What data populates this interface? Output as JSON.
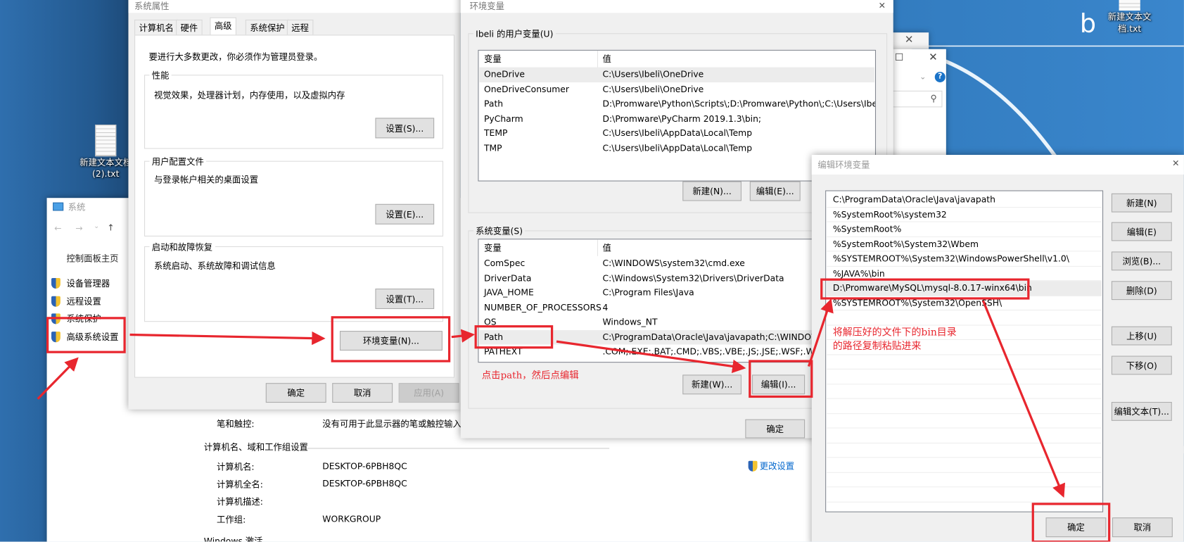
{
  "desktop": {
    "icons": [
      {
        "label_line1": "新建文本文档",
        "label_line2": "(2).txt"
      },
      {
        "label_line1": "新建文本文",
        "label_line2": "档.txt"
      }
    ],
    "letter": "b"
  },
  "system_window": {
    "title": "系统",
    "nav": {
      "back": "←",
      "forward": "→",
      "dropdown": "⌄",
      "up": "↑"
    },
    "sidebar": {
      "home": "控制面板主页",
      "items": [
        "设备管理器",
        "远程设置",
        "系统保护",
        "高级系统设置"
      ]
    },
    "pen_label": "笔和触控:",
    "pen_value": "没有可用于此显示器的笔或触控输入",
    "section_title": "计算机名、域和工作组设置",
    "fields": [
      {
        "label": "计算机名:",
        "value": "DESKTOP-6PBH8QC"
      },
      {
        "label": "计算机全名:",
        "value": "DESKTOP-6PBH8QC"
      },
      {
        "label": "计算机描述:",
        "value": ""
      },
      {
        "label": "工作组:",
        "value": "WORKGROUP"
      }
    ],
    "change_settings": "更改设置",
    "activation": "Windows 激活"
  },
  "system_properties": {
    "title": "系统属性",
    "tabs": [
      "计算机名",
      "硬件",
      "高级",
      "系统保护",
      "远程"
    ],
    "active_tab": "高级",
    "admin_note": "要进行大多数更改，你必须作为管理员登录。",
    "groups": [
      {
        "title": "性能",
        "desc": "视觉效果，处理器计划，内存使用，以及虚拟内存",
        "button": "设置(S)..."
      },
      {
        "title": "用户配置文件",
        "desc": "与登录帐户相关的桌面设置",
        "button": "设置(E)..."
      },
      {
        "title": "启动和故障恢复",
        "desc": "系统启动、系统故障和调试信息",
        "button": "设置(T)..."
      }
    ],
    "env_button": "环境变量(N)...",
    "ok": "确定",
    "cancel": "取消",
    "apply": "应用(A)"
  },
  "env_vars": {
    "title": "环境变量",
    "user_group": "Ibeli 的用户变量(U)",
    "col_var": "变量",
    "col_val": "值",
    "user_rows": [
      {
        "var": "OneDrive",
        "val": "C:\\Users\\Ibeli\\OneDrive"
      },
      {
        "var": "OneDriveConsumer",
        "val": "C:\\Users\\Ibeli\\OneDrive"
      },
      {
        "var": "Path",
        "val": "D:\\Promware\\Python\\Scripts\\;D:\\Promware\\Python\\;C:\\Users\\Ibe..."
      },
      {
        "var": "PyCharm",
        "val": "D:\\Promware\\PyCharm 2019.1.3\\bin;"
      },
      {
        "var": "TEMP",
        "val": "C:\\Users\\Ibeli\\AppData\\Local\\Temp"
      },
      {
        "var": "TMP",
        "val": "C:\\Users\\Ibeli\\AppData\\Local\\Temp"
      }
    ],
    "user_new": "新建(N)...",
    "user_edit": "编辑(E)...",
    "sys_group": "系统变量(S)",
    "sys_rows": [
      {
        "var": "ComSpec",
        "val": "C:\\WINDOWS\\system32\\cmd.exe"
      },
      {
        "var": "DriverData",
        "val": "C:\\Windows\\System32\\Drivers\\DriverData"
      },
      {
        "var": "JAVA_HOME",
        "val": "C:\\Program Files\\Java"
      },
      {
        "var": "NUMBER_OF_PROCESSORS",
        "val": "4"
      },
      {
        "var": "OS",
        "val": "Windows_NT"
      },
      {
        "var": "Path",
        "val": "C:\\ProgramData\\Oracle\\Java\\javapath;C:\\WINDOWS"
      },
      {
        "var": "PATHEXT",
        "val": ".COM;.EXE;.BAT;.CMD;.VBS;.VBE;.JS;.JSE;.WSF;.WSH;.MSC"
      }
    ],
    "sys_new": "新建(W)...",
    "sys_edit": "编辑(I)...",
    "ok": "确定"
  },
  "edit_env": {
    "title": "编辑环境变量",
    "entries": [
      "C:\\ProgramData\\Oracle\\Java\\javapath",
      "%SystemRoot%\\system32",
      "%SystemRoot%",
      "%SystemRoot%\\System32\\Wbem",
      "%SYSTEMROOT%\\System32\\WindowsPowerShell\\v1.0\\",
      "%JAVA%\\bin",
      "D:\\Promware\\MySQL\\mysql-8.0.17-winx64\\bin",
      "%SYSTEMROOT%\\System32\\OpenSSH\\"
    ],
    "selected_index": 6,
    "buttons": [
      "新建(N)",
      "编辑(E)",
      "浏览(B)...",
      "删除(D)",
      "上移(U)",
      "下移(O)",
      "编辑文本(T)..."
    ],
    "ok": "确定",
    "cancel": "取消"
  },
  "annotations": {
    "click_path": "点击path，然后点编辑",
    "paste_line1": "将解压好的文件下的bin目录",
    "paste_line2": "的路径复制粘贴进来",
    "color": "#e8262e"
  }
}
